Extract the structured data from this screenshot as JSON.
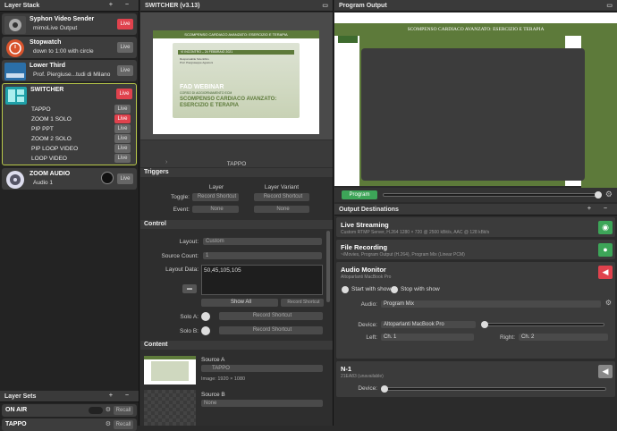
{
  "left": {
    "title": "Layer Stack",
    "controls": "+ −",
    "layers": [
      {
        "name": "Syphon Video Sender",
        "sub": "mimoLive Output",
        "live": "Live"
      },
      {
        "name": "Stopwatch",
        "sub": "down to 1:00 with circle",
        "live": "Live"
      },
      {
        "name": "Lower Third",
        "sub": "Prof. Piergiuse...tudi di Milano",
        "live": "Live"
      },
      {
        "name": "SWITCHER",
        "live": "Live"
      },
      {
        "name": "ZOOM AUDIO",
        "sub": "Audio 1",
        "live": "Live"
      }
    ],
    "switcher_items": [
      {
        "name": "TAPPO",
        "live": "Live"
      },
      {
        "name": "ZOOM 1 SOLO",
        "live": "Live"
      },
      {
        "name": "PIP PPT",
        "live": "Live"
      },
      {
        "name": "ZOOM 2 SOLO",
        "live": "Live"
      },
      {
        "name": "PIP LOOP VIDEO",
        "live": "Live"
      },
      {
        "name": "LOOP VIDEO",
        "live": "Live"
      }
    ],
    "sets_title": "Layer Sets",
    "sets": [
      {
        "name": "ON AIR",
        "recall": "Recall"
      },
      {
        "name": "TAPPO",
        "recall": "Recall"
      }
    ]
  },
  "mid": {
    "title": "SWITCHER (v3.13)",
    "preview": {
      "header": "SCOMPENSO CARDIACO AVANZATO: ESERCIZIO E TERAPIA",
      "date": "VI INCONTRO – 24 FEBBRAIO 2021",
      "small1": "Responsabile Scientifico",
      "small2": "Prof. Piergiuseppe Agostoni",
      "fad": "FAD WEBINAR",
      "fad_sub": "CORSO DI AGGIORNAMENTO ECM",
      "big": "SCOMPENSO CARDIACO AVANZATO: ESERCIZIO E TERAPIA"
    },
    "source_label": "TAPPO",
    "triggers": {
      "title": "Triggers",
      "col1": "Layer",
      "col2": "Layer Variant",
      "toggle": "Toggle:",
      "event": "Event:",
      "record": "Record Shortcut",
      "none": "None"
    },
    "control": {
      "title": "Control",
      "layout_label": "Layout:",
      "layout_val": "Custom",
      "count_label": "Source Count:",
      "count_val": "1",
      "data_label": "Layout Data:",
      "data_val": "50,45,105,105",
      "show_all": "Show All",
      "record": "Record Shortcut",
      "soloa": "Solo A:",
      "solob": "Solo B:"
    },
    "content": {
      "title": "Content",
      "srcA": "Source A",
      "srcA_val": "TAPPO",
      "srcA_info": "Image: 1920 × 1080",
      "srcB": "Source B",
      "srcB_val": "None"
    }
  },
  "right": {
    "title": "Program Output",
    "program_header": "SCOMPENSO CARDIACO AVANZATO: ESERCIZIO E TERAPIA",
    "program_btn": "Program",
    "dest_title": "Output Destinations",
    "dest": {
      "stream": "Live Streaming",
      "stream_sub": "Custom RTMP Server, H.264 1280 × 720 @ 2500 kBit/s, AAC @ 128 kBit/s",
      "file": "File Recording",
      "file_sub": "~/Movies, Program Output (H.264), Program Mix (Linear PCM)",
      "audio": "Audio Monitor",
      "audio_sub": "Altoparlanti MacBook Pro",
      "start": "Start with show",
      "stop": "Stop with show",
      "audio_label": "Audio:",
      "audio_val": "Program Mix",
      "device_label": "Device:",
      "device_val": "Altoparlanti MacBook Pro",
      "left_label": "Left:",
      "left_val": "Ch. 1",
      "right_label": "Right:",
      "right_val": "Ch. 2",
      "n1": "N-1",
      "n1_sub": "21EA83 (unavailable)",
      "n1_device": "Device:"
    }
  },
  "colors": {
    "live": "#e0424d",
    "green": "#3da558",
    "accent": "#5d7a3a"
  }
}
